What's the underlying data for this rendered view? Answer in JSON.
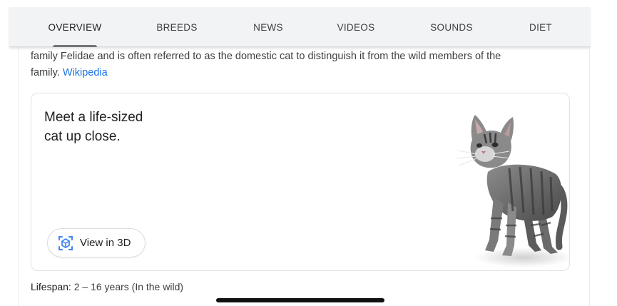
{
  "tabs": [
    {
      "label": "OVERVIEW",
      "active": true
    },
    {
      "label": "BREEDS",
      "active": false
    },
    {
      "label": "NEWS",
      "active": false
    },
    {
      "label": "VIDEOS",
      "active": false
    },
    {
      "label": "SOUNDS",
      "active": false
    },
    {
      "label": "DIET",
      "active": false
    }
  ],
  "description": {
    "line1": "family Felidae and is often referred to as the domestic cat to distinguish it from the wild members of the",
    "line2_prefix": "family.",
    "source_link": "Wikipedia"
  },
  "ar_card": {
    "title_line1": "Meet a life-sized",
    "title_line2": "cat up close.",
    "button_label": "View in 3D",
    "button_icon": "view-in-3d-icon",
    "image": "tabby-cat-3d-model"
  },
  "facts": {
    "lifespan_label": "Lifespan:",
    "lifespan_value": "2 – 16 years (In the wild)"
  },
  "colors": {
    "tab_bar_bg": "#f1f3f4",
    "link": "#1a73e8",
    "icon_blue": "#4285f4",
    "text": "#202124"
  }
}
